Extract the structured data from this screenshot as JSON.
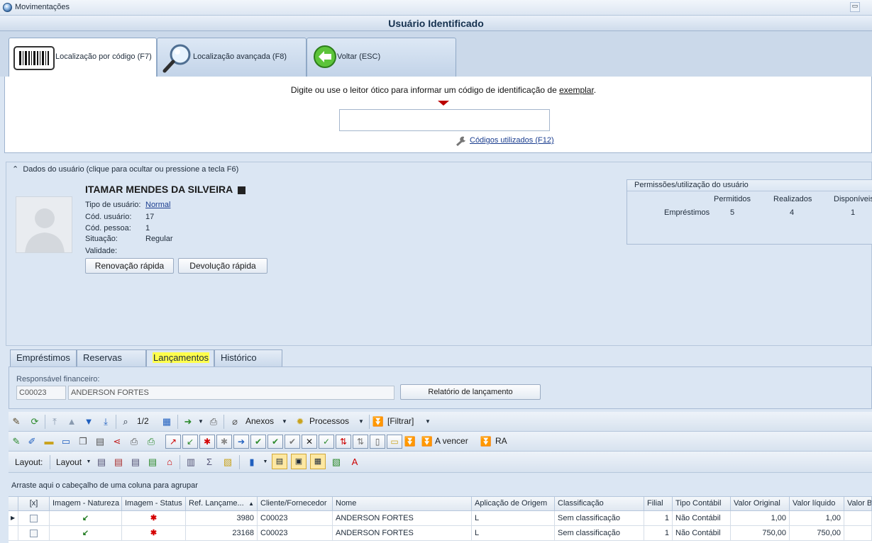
{
  "window": {
    "title": "Movimentações",
    "header": "Usuário Identificado",
    "minimize_glyph": "▭"
  },
  "top_tabs": [
    {
      "label": "Localização por código (F7)",
      "icon": "barcode-icon"
    },
    {
      "label": "Localização avançada (F8)",
      "icon": "magnifier-icon"
    },
    {
      "label": "Voltar (ESC)",
      "icon": "back-arrow-icon"
    }
  ],
  "locate": {
    "instruction": "Digite ou use o leitor ótico para informar um código de identificação de",
    "instruction_link": "exemplar",
    "instruction_end": ".",
    "code_value": "",
    "codes_link": "Códigos utilizados (F12)"
  },
  "user": {
    "section_title": "Dados do usuário (clique para ocultar ou pressione a tecla F6)",
    "name": "ITAMAR MENDES DA SILVEIRA",
    "fields": [
      {
        "label": "Tipo de usuário:",
        "value": "Normal"
      },
      {
        "label": "Cód. usuário:",
        "value": "17"
      },
      {
        "label": "Cód. pessoa:",
        "value": "1"
      },
      {
        "label": "Situação:",
        "value": "Regular"
      },
      {
        "label": "Validade:",
        "value": ""
      }
    ],
    "buttons": {
      "renew": "Renovação rápida",
      "return": "Devolução rápida"
    }
  },
  "permissions": {
    "title": "Permissões/utilização do usuário",
    "columns": [
      "Permitidos",
      "Realizados",
      "Disponíveis"
    ],
    "row_label": "Empréstimos",
    "values": [
      "5",
      "4",
      "1"
    ]
  },
  "lower_tabs": [
    "Empréstimos",
    "Reservas",
    "Lançamentos",
    "Histórico"
  ],
  "responsavel": {
    "label": "Responsável financeiro:",
    "code": "C00023",
    "name": "ANDERSON FORTES",
    "report_button": "Relatório de lançamento"
  },
  "toolbar1": {
    "page": "1/2",
    "anexos": "Anexos",
    "processos": "Processos",
    "filtrar": "[Filtrar]"
  },
  "toolbar2": {
    "a_vencer": "A vencer",
    "ra": "RA"
  },
  "toolbar3": {
    "layout_label": "Layout:",
    "layout_menu": "Layout"
  },
  "grid": {
    "group_hint": "Arraste aqui o cabeçalho de uma coluna para agrupar",
    "columns": [
      "[x]",
      "Imagem - Natureza",
      "Imagem - Status",
      "Ref. Lançame...",
      "Cliente/Fornecedor",
      "Nome",
      "Aplicação de Origem",
      "Classificação",
      "Filial",
      "Tipo Contábil",
      "Valor Original",
      "Valor líquido",
      "Valor Ba"
    ],
    "rows": [
      {
        "ref": "3980",
        "cliente": "C00023",
        "nome": "ANDERSON FORTES",
        "aplicacao": "L",
        "classificacao": "Sem classificação",
        "filial": "1",
        "tipo": "Não Contábil",
        "original": "1,00",
        "liquido": "1,00"
      },
      {
        "ref": "23168",
        "cliente": "C00023",
        "nome": "ANDERSON FORTES",
        "aplicacao": "L",
        "classificacao": "Sem classificação",
        "filial": "1",
        "tipo": "Não Contábil",
        "original": "750,00",
        "liquido": "750,00"
      }
    ]
  },
  "colors": {
    "highlight": "#ffff4d",
    "accent": "#1a3d8f",
    "status_red": "#d40000",
    "natureza_green": "#1e7a1e"
  }
}
